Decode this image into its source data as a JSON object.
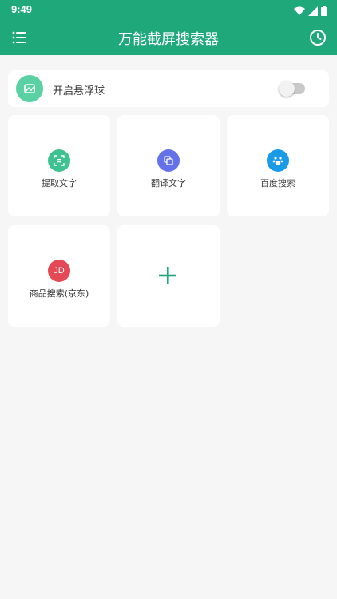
{
  "status_bar": {
    "time": "9:49",
    "icons": [
      "wifi-icon",
      "signal-icon",
      "battery-icon"
    ]
  },
  "app_bar": {
    "title": "万能截屏搜索器",
    "menu_icon": "menu-icon",
    "history_icon": "clock-icon"
  },
  "float_ball": {
    "label": "开启悬浮球",
    "enabled": false,
    "icon": "mountain-icon"
  },
  "tiles": [
    {
      "label": "提取文字",
      "icon": "scan-text-icon",
      "color": "#3ec28f"
    },
    {
      "label": "翻译文字",
      "icon": "translate-icon",
      "color": "#6471e8"
    },
    {
      "label": "百度搜索",
      "icon": "paw-icon",
      "color": "#1a9be8"
    },
    {
      "label": "商品搜索(京东)",
      "icon_text": "JD",
      "color": "#e34a55"
    },
    {
      "label": "",
      "icon": "plus-icon",
      "color": "#1fa97a"
    }
  ],
  "colors": {
    "primary": "#1fa97a",
    "background": "#f6f6f6"
  }
}
